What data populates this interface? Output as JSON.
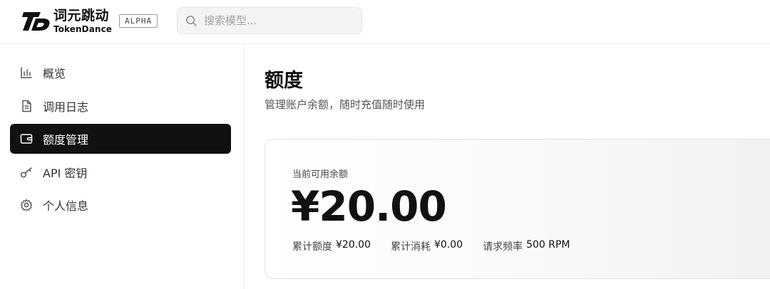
{
  "brand": {
    "name_cn": "词元跳动",
    "name_en": "TokenDance",
    "badge": "ALPHA"
  },
  "search": {
    "placeholder": "搜索模型..."
  },
  "sidebar": {
    "items": [
      {
        "label": "概览",
        "icon": "bar-chart-icon",
        "active": false
      },
      {
        "label": "调用日志",
        "icon": "document-icon",
        "active": false
      },
      {
        "label": "额度管理",
        "icon": "wallet-icon",
        "active": true
      },
      {
        "label": "API 密钥",
        "icon": "key-icon",
        "active": false
      },
      {
        "label": "个人信息",
        "icon": "gear-icon",
        "active": false
      }
    ]
  },
  "main": {
    "title": "额度",
    "subtitle": "管理账户余额，随时充值随时使用",
    "balance_card": {
      "label": "当前可用余额",
      "amount": "¥20.00",
      "stats": [
        {
          "label": "累计额度",
          "value": "¥20.00"
        },
        {
          "label": "累计消耗",
          "value": "¥0.00"
        },
        {
          "label": "请求频率",
          "value": "500 RPM"
        }
      ]
    }
  },
  "colors": {
    "active_nav_bg": "#111111",
    "active_nav_text": "#ffffff",
    "text_primary": "#111111",
    "text_secondary": "#555555",
    "border": "#ececec",
    "search_bg": "#f4f4f5"
  }
}
